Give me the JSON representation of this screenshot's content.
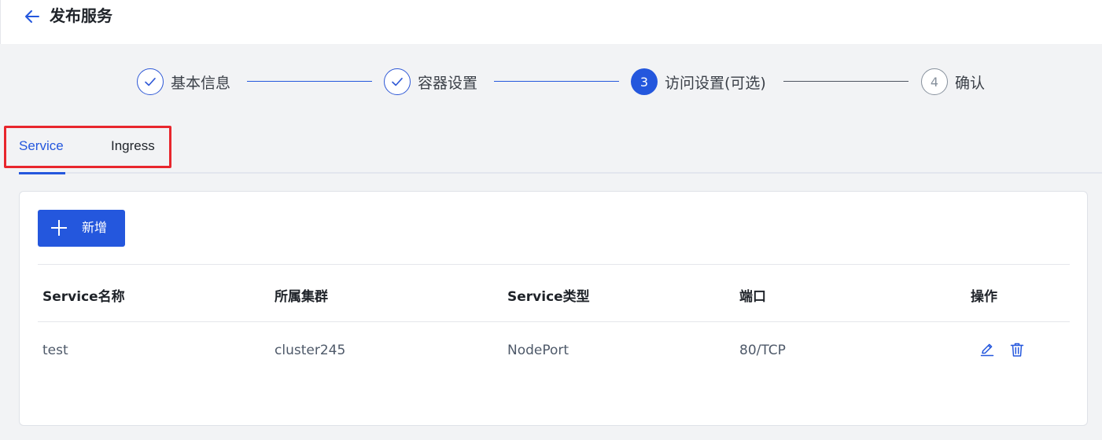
{
  "header": {
    "back_icon": "arrow-left-icon",
    "title": "发布服务"
  },
  "steps": [
    {
      "label": "基本信息",
      "status": "done",
      "marker": "check-icon"
    },
    {
      "label": "容器设置",
      "status": "done",
      "marker": "check-icon"
    },
    {
      "label": "访问设置(可选)",
      "status": "active",
      "number": "3"
    },
    {
      "label": "确认",
      "status": "todo",
      "number": "4"
    }
  ],
  "tabs": [
    {
      "label": "Service",
      "active": true
    },
    {
      "label": "Ingress",
      "active": false
    }
  ],
  "toolbar": {
    "add_label": "新增",
    "add_icon": "plus-icon"
  },
  "table": {
    "columns": [
      "Service名称",
      "所属集群",
      "Service类型",
      "端口",
      "操作"
    ],
    "rows": [
      {
        "name": "test",
        "cluster": "cluster245",
        "type": "NodePort",
        "port": "80/TCP",
        "actions": [
          "edit-icon",
          "delete-icon"
        ]
      }
    ]
  },
  "colors": {
    "accent": "#2457dd",
    "highlight": "#e8262d",
    "page_bg": "#f2f3f5"
  }
}
